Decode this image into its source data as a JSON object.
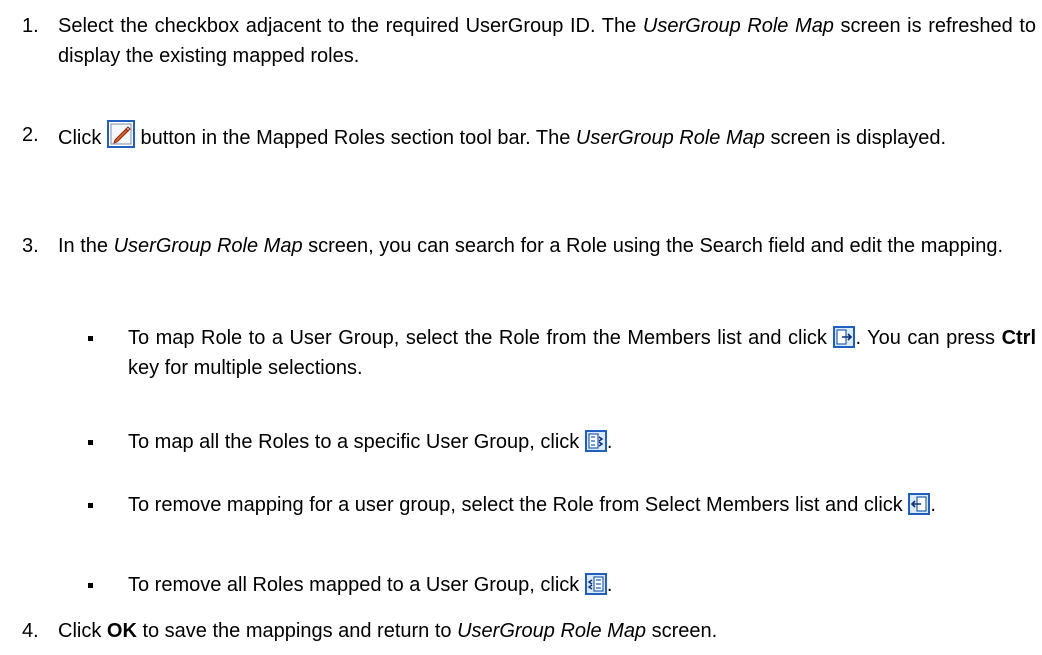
{
  "steps": [
    {
      "num": "1.",
      "t1": "Select the checkbox adjacent to the required UserGroup ID. The ",
      "t2": "UserGroup Role Map",
      "t3": " screen is refreshed to display the existing mapped roles."
    },
    {
      "num": "2.",
      "t1": "Click ",
      "icon": "edit-icon",
      "t2": " button in the Mapped Roles section tool bar. The ",
      "t3": "UserGroup Role Map",
      "t4": " screen is displayed."
    },
    {
      "num": "3.",
      "t1": "In the ",
      "t2": "UserGroup Role Map",
      "t3": " screen, you can search for a Role using the Search field and edit the mapping."
    },
    {
      "num": "4.",
      "t1": "Click ",
      "t2": "OK",
      "t3": " to save the mappings and return to ",
      "t4": "UserGroup Role Map",
      "t5": " screen."
    }
  ],
  "subitems": [
    {
      "t1": "To map Role to a User Group, select the Role from the Members list and click ",
      "icon": "move-selected-icon",
      "t2": ". You can press ",
      "t3": "Ctrl",
      "t4": " key for multiple selections."
    },
    {
      "t1": "To map all the Roles to a specific User Group, click ",
      "icon": "move-all-icon",
      "t2": "."
    },
    {
      "t1": "To remove mapping for a user group, select the Role from Select Members list and click ",
      "icon": "remove-selected-icon",
      "t2": "."
    },
    {
      "t1": "To remove all Roles mapped to a User Group, click ",
      "icon": "remove-all-icon",
      "t2": "."
    }
  ],
  "colors": {
    "icon_border": "#1f5fbf",
    "icon_fill": "#dce9f7",
    "edit_pencil": "#e0602a"
  }
}
